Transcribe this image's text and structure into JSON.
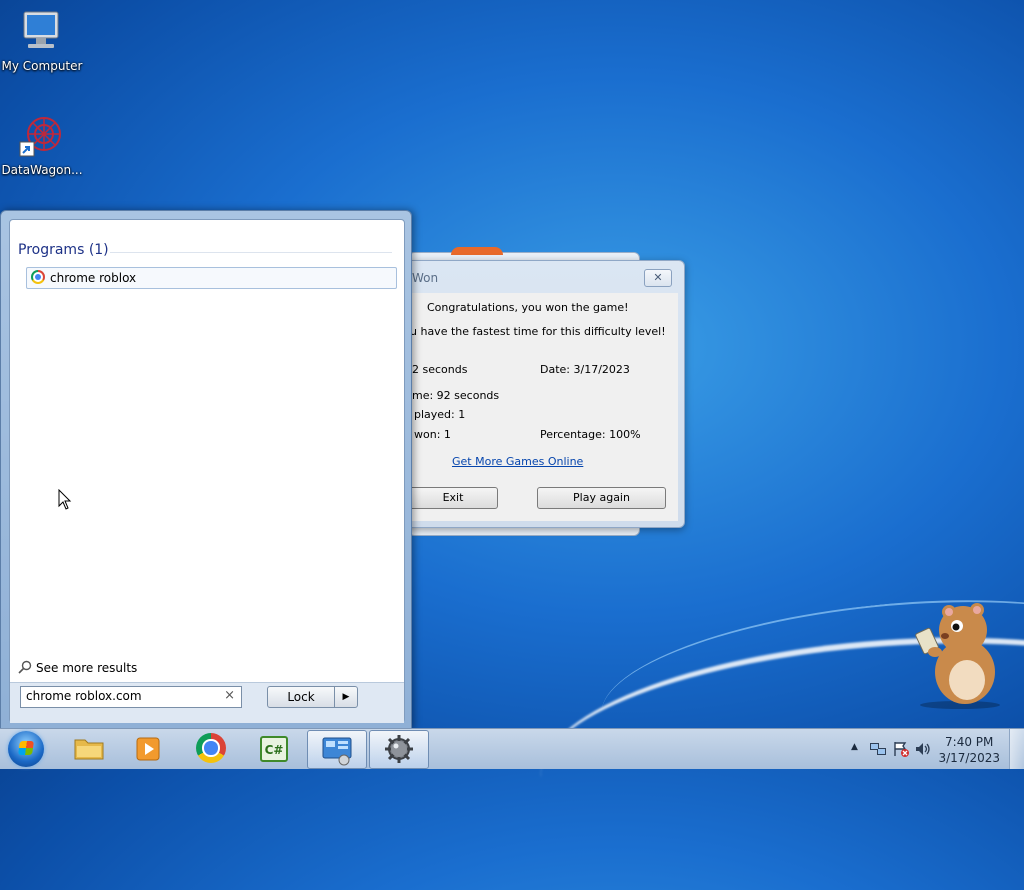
{
  "desktop": {
    "icons": [
      {
        "label": "My Computer"
      },
      {
        "label": "DataWagon..."
      }
    ]
  },
  "game_dialog": {
    "title": "Won",
    "close_label": "✕",
    "congrats": "Congratulations, you won the game!",
    "fastest": "u have the fastest time for this difficulty level!",
    "time": "2 seconds",
    "date": "Date: 3/17/2023",
    "best_time": "me: 92 seconds",
    "played": "played: 1",
    "won": "won: 1",
    "percentage": "Percentage: 100%",
    "link": "Get More Games Online",
    "exit_label": "Exit",
    "play_again_label": "Play again"
  },
  "start_menu": {
    "programs_header": "Programs (1)",
    "program_item": "chrome roblox",
    "see_more": "See more results",
    "search_value": "chrome roblox.com",
    "clear_label": "×",
    "lock_label": "Lock",
    "arrow_label": "▶"
  },
  "taskbar": {
    "time": "7:40 PM",
    "date": "3/17/2023",
    "tray_arrow": "▲"
  }
}
